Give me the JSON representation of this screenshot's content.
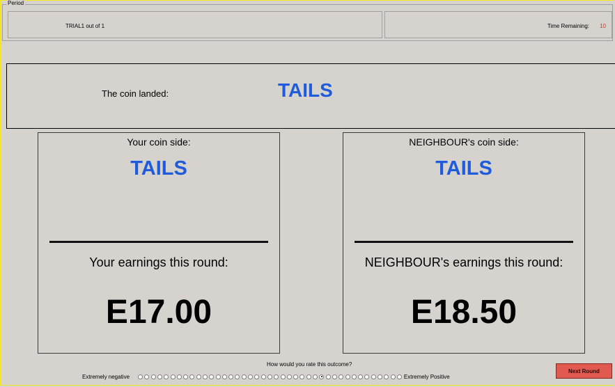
{
  "period": {
    "legend": "Period",
    "trial_text": "TRIAL1   out of   1",
    "time_label": "Time Remaining:",
    "time_value": "10"
  },
  "landed": {
    "label": "The coin landed:",
    "value": "TAILS"
  },
  "you": {
    "title": "Your coin side:",
    "side": "TAILS",
    "earnings_label": "Your earnings this round:",
    "earnings_value": "E17.00"
  },
  "neighbour": {
    "title": "NEIGHBOUR's coin side:",
    "side": "TAILS",
    "earnings_label": "NEIGHBOUR's earnings this round:",
    "earnings_value": "E18.50"
  },
  "rating": {
    "question": "How would you rate this outcome?",
    "left_label": "Extremely negative",
    "right_label": "Extremely Positive",
    "option_count": 41,
    "selected_index": 28
  },
  "next_button": {
    "label": "Next Round"
  },
  "colors": {
    "accent_blue": "#1f5bdb",
    "time_red": "#c0392b",
    "button_red": "#e25a4f",
    "frame_yellow": "#f2e81c"
  }
}
